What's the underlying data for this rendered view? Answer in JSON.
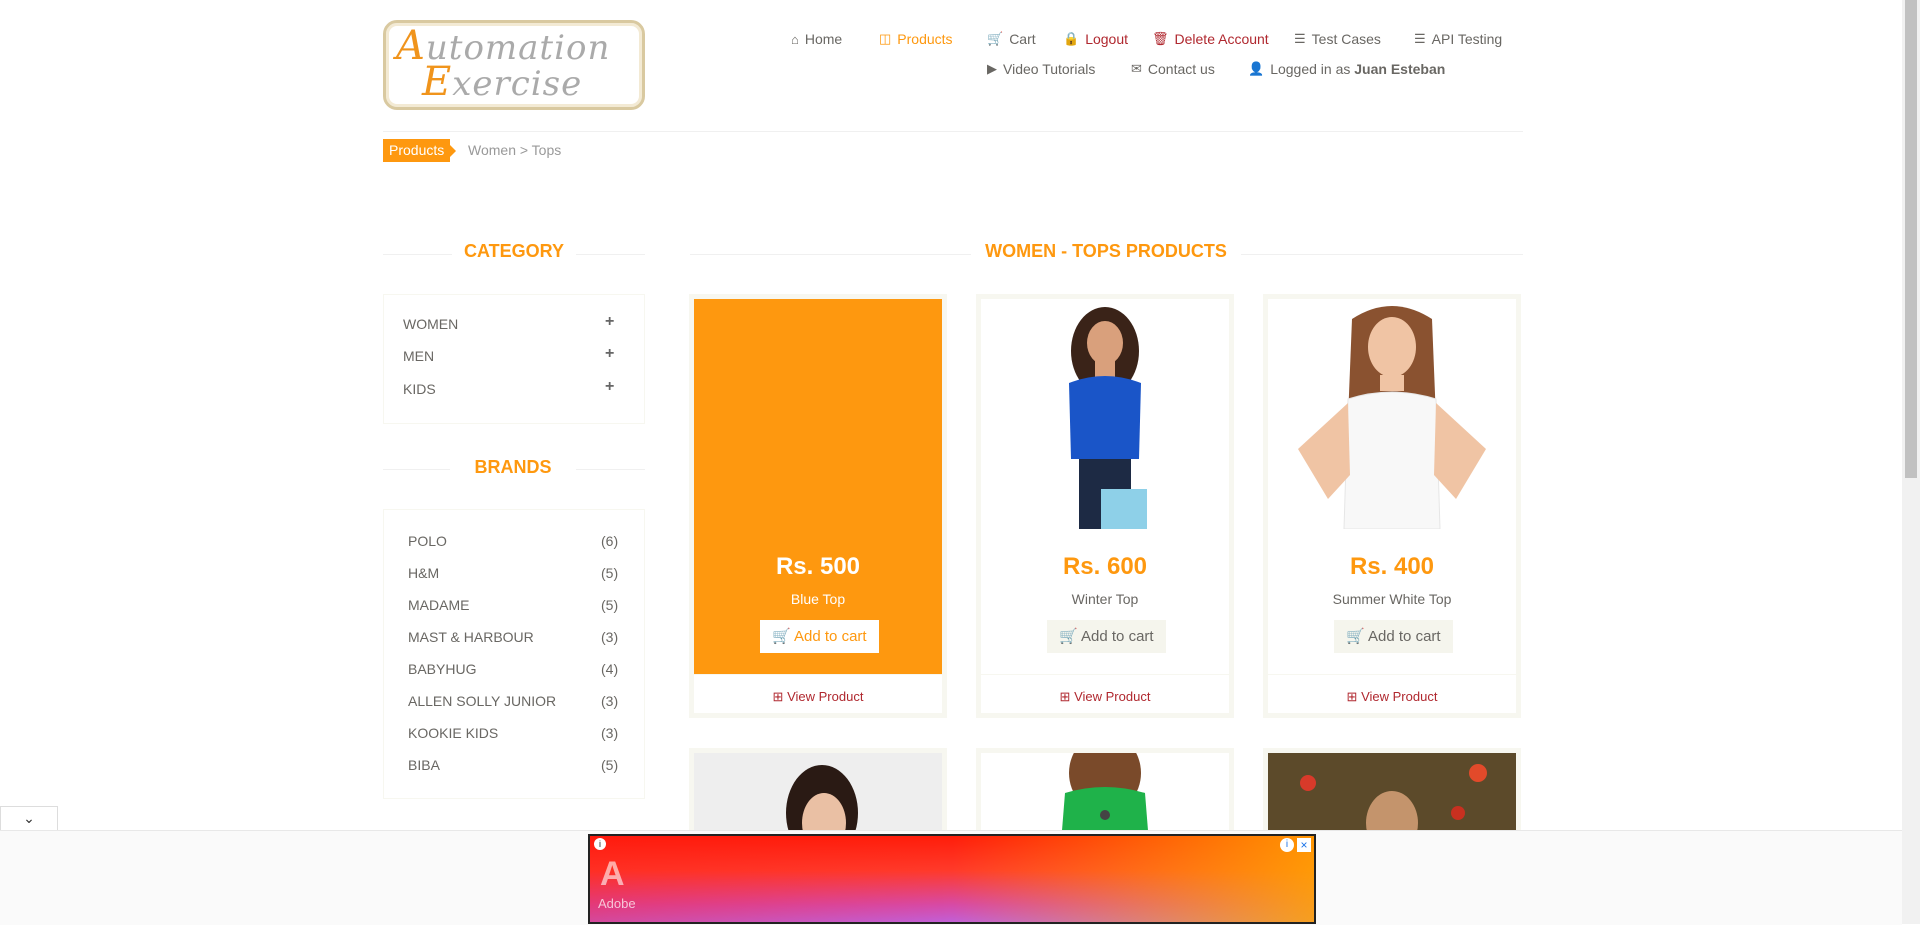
{
  "logo": {
    "line1_cap": "A",
    "line1_rest": "utomation",
    "line2_cap": "E",
    "line2_rest": "xercise"
  },
  "nav": {
    "home": "Home",
    "products": "Products",
    "cart": "Cart",
    "logout": "Logout",
    "delete_account": "Delete Account",
    "test_cases": "Test Cases",
    "api_testing": "API Testing",
    "video_tutorials": "Video Tutorials",
    "contact_us": "Contact us",
    "logged_in_prefix": "Logged in as",
    "logged_in_user": "Juan Esteban"
  },
  "breadcrumb": {
    "badge": "Products",
    "path": "Women > Tops"
  },
  "sidebar": {
    "category_title": "CATEGORY",
    "categories": [
      "WOMEN",
      "MEN",
      "KIDS"
    ],
    "brands_title": "BRANDS",
    "brands": [
      {
        "name": "POLO",
        "count": "(6)"
      },
      {
        "name": "H&M",
        "count": "(5)"
      },
      {
        "name": "MADAME",
        "count": "(5)"
      },
      {
        "name": "MAST & HARBOUR",
        "count": "(3)"
      },
      {
        "name": "BABYHUG",
        "count": "(4)"
      },
      {
        "name": "ALLEN SOLLY JUNIOR",
        "count": "(3)"
      },
      {
        "name": "KOOKIE KIDS",
        "count": "(3)"
      },
      {
        "name": "BIBA",
        "count": "(5)"
      }
    ]
  },
  "main": {
    "title": "WOMEN - TOPS PRODUCTS",
    "add_to_cart": "Add to cart",
    "view_product": "View Product",
    "products": [
      {
        "price": "Rs. 500",
        "name": "Blue Top"
      },
      {
        "price": "Rs. 600",
        "name": "Winter Top"
      },
      {
        "price": "Rs. 400",
        "name": "Summer White Top"
      }
    ]
  },
  "ad": {
    "brand": "Adobe"
  },
  "colors": {
    "accent": "#fe980f",
    "danger": "#b0282f",
    "text": "#696763"
  }
}
